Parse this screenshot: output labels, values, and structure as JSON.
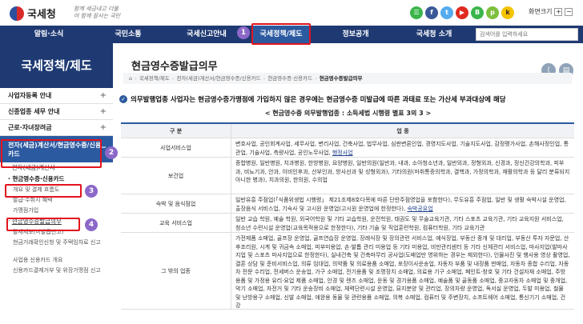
{
  "header": {
    "logo_text": "국세청",
    "slogan": "함께 세금내고 더불어 함께 잘사는 국민",
    "font_size_label": "화면크기",
    "font_plus": "+",
    "font_minus": "−"
  },
  "gnb": {
    "items": [
      "알림·소식",
      "국민소통",
      "국세신고안내",
      "국세정책/제도",
      "정보공개",
      "국세청 소개"
    ],
    "active_index": 3,
    "search_placeholder": "검색어를 입력하세요"
  },
  "sidebar": {
    "title": "국세정책/제도",
    "items": [
      "사업자등록 안내",
      "신종업종 세무 안내",
      "근로·자녀장려금"
    ],
    "active": "전자(세금)계산서/현금영수증/신용카드",
    "sub": [
      "전자(세금)계산서",
      "현금영수증·신용카드"
    ],
    "subsub": [
      "개요 및 결제 흐름도",
      "발급·수취시 혜택",
      "가맹점가입",
      "현금영수증발급의무",
      "탈세제보(미발급신고)",
      "현금거래확인신청 및 주택임차료 신고",
      "사업용 신용카드 개요",
      "신용카드결제거부 및 위장가맹점 신고"
    ]
  },
  "main": {
    "title": "현금영수증발급의무",
    "breadcrumb": [
      "국세정책/제도",
      "전자(세금)계산서/현금영수증/신용카드",
      "현금영수증·신용카드",
      "현금영수증발급의무"
    ],
    "heading": "의무발행업종 사업자는 현금영수증가맹점에 가입하지 않은 경우에는 현금영수증 미발급에 따른 과태료 또는 가산세 부과대상에 해당",
    "subheading": "< 현금영수증 의무발행업종 : 소득세법 시행령 별표 3의 3 >",
    "table_headers": [
      "구 분",
      "업 종"
    ],
    "rows": [
      {
        "category": "사업서비스업",
        "text": "변호사업, 공인회계사업, 세무사업, 변리사업, 건축사업, 법무사업, 심판변론인업, 경영지도사업, 기술지도사업, 감정평가사업, 손해사정인업, 통관업, 기술사업, 측량사업, 공인노무사업, ",
        "link": "행정사업"
      },
      {
        "category": "보건업",
        "text": "종합병원, 일반병원, 치과병원, 한방병원, 요양병원, 일반의원(일반과, 내과, 소아청소년과, 일반외과, 정형외과, 신경과, 정신건강의학과, 피부과, 비뇨기과, 안과, 이비인후과, 산부인과, 방사선과 및 성형외과), 기타의원(마취통증의학과, 결핵과, 가정의학과, 재활의학과 등 달리 분류되지 아니한 병과), 치과의원, 한의원, 수의업",
        "link": ""
      },
      {
        "category": "숙박 및 음식점업",
        "text": "일반유흥 주점업(「식품위생법 시행령」 제21조제8호다목에 따른 단란주점영업을 포함한다), 무도유흥 주점업, 일반 및 생활 숙박시설 운영업, 출장음식 서비스업, 기숙사 및 고시원 운영업(고시원 운영업에 한정한다), ",
        "link": "숙박공유업"
      },
      {
        "category": "교육 서비스업",
        "text": "일반 교습 학원, 예술 학원, 외국어학원 및 기타 교습학원, 운전학원, 태권도 및 무술교육기관, 기타 스포츠 교육기관, 기타 교육지원 서비스업, 청소년 수련시설 운영업(교육목적용으로 한정한다), 기타 기술 및 직업훈련학원, 컴퓨터학원, 기타 교육기관",
        "link": ""
      },
      {
        "category": "그 밖의 업종",
        "text": "가전제품 소매업, 골프장 운영업, 골프연습장 운영업, 장례식장 및 장의관련 서비스업, 예식장업, 부동산 중개 및 대리업, 부동산 투자 자문업, 산후조리원, 시계 및 귀금속 소매업, 피부미용업, 손·발톱 관리 미용업 등 기타 미용업, 비만관리센터 등 기타 신체관리 서비스업, 마사지업(발마사지업 및 스포츠 마사지업으로 한정한다), 실내건축 및 건축마무리 공사업(도배업만 영위하는 경우는 제외한다), 인물사진 및 행사용 영상 촬영업, 결혼 상담 및 준비서비스업, 의류 임대업, 의약품 및 의료용품 소매업, 포장이사운송업, 자동차 부품 및 내장품 판매업, 자동차 종합 수리업, 자동차 전문 수리업, 전세버스 운송업, 가구 소매업, 전기용품 및 조명장치 소매업, 의료용 기구 소매업, 페인트·창호 및 기타 건설자재 소매업, 주방용품 및 가정용 유리·요업 제품 소매업, 안경 및 렌즈 소매업, 운동 및 경기용품 소매업, 예술품 및 골동품 소매업, 중고자동차 소매업 및 중개업, 악기 소매업, 자전거 및 기타 운송장비 소매업, 체력단련시설 운영업, 묘지분양 및 관리업, 장의차량 운영업, 독서실 운영업, 두발 미용업, 철물 및 난방용구 소매업, 신발 소매업, 애완용 동물 및 관련용품 소매업, 의복 소매업, 컴퓨터 및 주변장치, 소프트웨어 소매업, 통신기기 소매업, 건강"
      }
    ]
  },
  "annotations": [
    "1",
    "2",
    "3",
    "4"
  ],
  "colors": {
    "nav_blue": "#1f3a73",
    "active_blue": "#2c5aa0",
    "annotation_red": "#e3131d",
    "badge_purple": "#8c68c9"
  }
}
